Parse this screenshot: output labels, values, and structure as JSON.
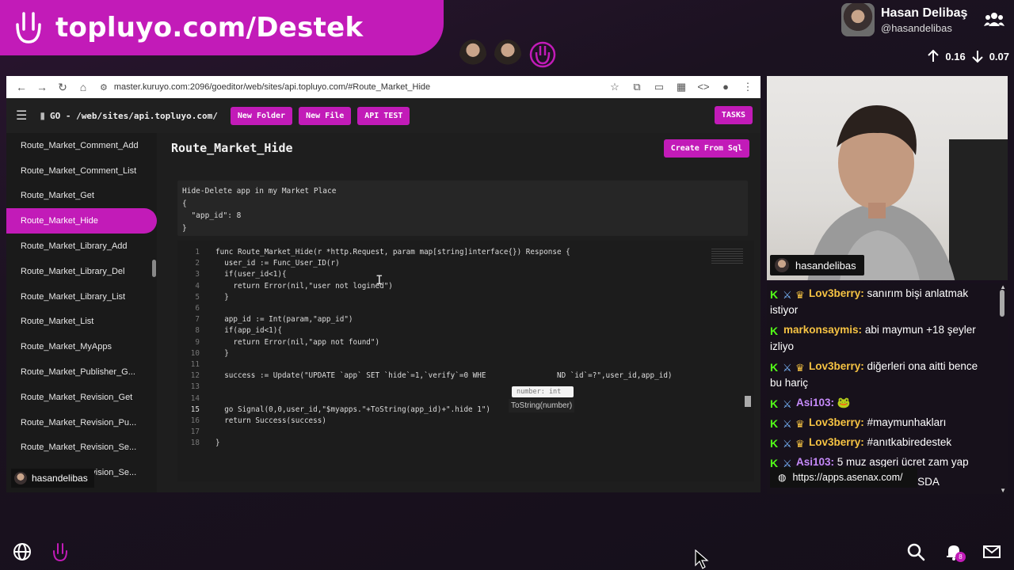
{
  "overlay": {
    "brand": "topluyo.com/Destek",
    "streamer_name": "Hasan Delibaş",
    "streamer_handle": "@hasandelibas",
    "upload": "0.16",
    "download": "0.07"
  },
  "browser": {
    "url": "master.kuruyo.com:2096/goeditor/web/sites/api.topluyo.com/#Route_Market_Hide"
  },
  "toolbar": {
    "path": "GO - /web/sites/api.topluyo.com/",
    "new_folder": "New Folder",
    "new_file": "New File",
    "api_test": "API TEST",
    "tasks": "TASKS"
  },
  "sidebar": {
    "items": [
      "Route_Market_Comment_Add",
      "Route_Market_Comment_List",
      "Route_Market_Get",
      "Route_Market_Hide",
      "Route_Market_Library_Add",
      "Route_Market_Library_Del",
      "Route_Market_Library_List",
      "Route_Market_List",
      "Route_Market_MyApps",
      "Route_Market_Publisher_G...",
      "Route_Market_Revision_Get",
      "Route_Market_Revision_Pu...",
      "Route_Market_Revision_Se...",
      "Route_Market_Revision_Se..."
    ],
    "active_index": 3,
    "footer_tag": "hasandelibas"
  },
  "editor": {
    "title": "Route_Market_Hide",
    "create_from_sql": "Create From Sql",
    "description": "Hide-Delete app in my Market Place\n{\n  \"app_id\": 8\n}",
    "lines": [
      "func Route_Market_Hide(r *http.Request, param map[string]interface{}) Response {",
      "  user_id := Func_User_ID(r)",
      "  if(user_id<1){",
      "    return Error(nil,\"user not logined\")",
      "  }",
      "",
      "  app_id := Int(param,\"app_id\")",
      "  if(app_id<1){",
      "    return Error(nil,\"app not found\")",
      "  }",
      "",
      "  success := Update(\"UPDATE `app` SET `hide`=1,`verify`=0 WHE                ND `id`=?\",user_id,app_id)",
      "",
      "",
      "  go Signal(0,0,user_id,\"$myapps.\"+ToString(app_id)+\".hide 1\")",
      "  return Success(success)",
      "",
      "}"
    ],
    "current_line": 15,
    "tooltip_type": "number: int",
    "tooltip_signature": "ToString(number)"
  },
  "webcam": {
    "tag": "hasandelibas"
  },
  "chat": {
    "messages": [
      {
        "badges": [
          "k",
          "sword",
          "crown"
        ],
        "user": "Lov3berry:",
        "color": "#f6c343",
        "text": "sanırım bişi anlatmak istiyor"
      },
      {
        "badges": [
          "k"
        ],
        "user": "markonsaymis:",
        "color": "#f6c343",
        "text": "abi maymun +18 şeyler izliyo"
      },
      {
        "badges": [
          "k",
          "sword",
          "crown"
        ],
        "user": "Lov3berry:",
        "color": "#f6c343",
        "text": "diğerleri ona aitti bence bu hariç"
      },
      {
        "badges": [
          "k",
          "sword"
        ],
        "user": "Asi103:",
        "color": "#c58af9",
        "text": "🐸"
      },
      {
        "badges": [
          "k",
          "sword",
          "crown"
        ],
        "user": "Lov3berry:",
        "color": "#f6c343",
        "text": "#maymunhakları"
      },
      {
        "badges": [
          "k",
          "sword",
          "crown"
        ],
        "user": "Lov3berry:",
        "color": "#f6c343",
        "text": "#anıtkabiredestek"
      },
      {
        "badges": [
          "k",
          "sword"
        ],
        "user": "Asi103:",
        "color": "#c58af9",
        "text": "5 muz asgeri ücret zam yap"
      },
      {
        "badges": [
          "k",
          "sword"
        ],
        "user": "Asi103:",
        "color": "#c58af9",
        "text": "KLAMSDKMKALSDA"
      }
    ],
    "link": "https://apps.asenax.com/"
  },
  "bottom": {
    "notification_count": "8"
  }
}
